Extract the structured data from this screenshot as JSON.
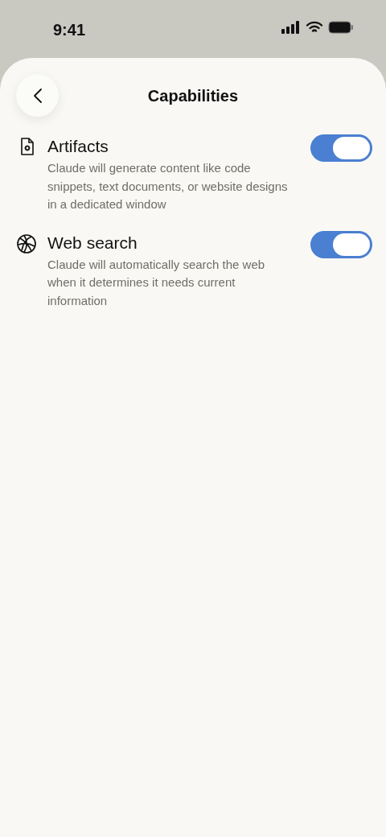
{
  "status_bar": {
    "time": "9:41"
  },
  "header": {
    "title": "Capabilities"
  },
  "capabilities": [
    {
      "kind": "document",
      "title": "Artifacts",
      "description": "Claude will generate content like code snippets, text documents, or website designs in a dedicated window",
      "on": true
    },
    {
      "kind": "globe",
      "title": "Web search",
      "description": "Claude will automatically search the web when it determines it needs current information",
      "on": true
    }
  ]
}
